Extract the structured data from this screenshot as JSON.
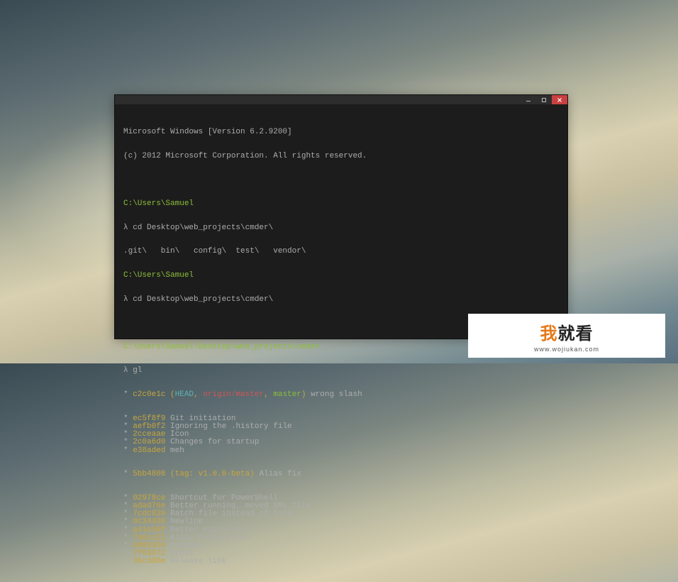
{
  "header": {
    "line1": "Microsoft Windows [Version 6.2.9200]",
    "line2": "(c) 2012 Microsoft Corporation. All rights reserved."
  },
  "block1": {
    "cwd": "C:\\Users\\Samuel",
    "prompt": "λ ",
    "cmd": "cd Desktop\\web_projects\\cmder\\",
    "listing": ".git\\   bin\\   config\\  test\\   vendor\\"
  },
  "block2": {
    "cwd": "C:\\Users\\Samuel",
    "prompt": "λ ",
    "cmd": "cd Desktop\\web_projects\\cmder\\"
  },
  "block3": {
    "cwd": "C:\\Users\\Samuel\\Desktop\\web_projects\\cmder",
    "prompt": "λ ",
    "cmd": "gl"
  },
  "firstCommit": {
    "star": "* ",
    "hash": "c2c0e1c",
    "open": " (",
    "head": "HEAD",
    "sep1": ", ",
    "origin": "origin/master",
    "sep2": ", ",
    "master": "master",
    "close": ")",
    "msg": " wrong slash"
  },
  "commits": [
    {
      "hash": "ec5f8f9",
      "msg": " Git initiation"
    },
    {
      "hash": "aefb0f2",
      "msg": " Ignoring the .history file"
    },
    {
      "hash": "2cceaae",
      "msg": " Icon"
    },
    {
      "hash": "2c0a6d0",
      "msg": " Changes for startup"
    },
    {
      "hash": "e38aded",
      "msg": " meh"
    }
  ],
  "tagCommit": {
    "star": "* ",
    "hash": "5bb4808",
    "open": " (",
    "tag": "tag: v1.0.0-beta",
    "close": ")",
    "msg": " Alias fix"
  },
  "commits2": [
    {
      "hash": "02978ce",
      "msg": " Shortcut for PowerShell"
    },
    {
      "hash": "adad76e",
      "msg": " Better running, moved XML file"
    },
    {
      "hash": "7cdc039",
      "msg": " Batch file instead of link"
    },
    {
      "hash": "8c34d36",
      "msg": " Newline"
    },
    {
      "hash": "a41e50f",
      "msg": " Better explained"
    },
    {
      "hash": "7a6cc21",
      "msg": " Alias explanation"
    },
    {
      "hash": "9d86358",
      "msg": " License"
    },
    {
      "hash": "7f63672",
      "msg": " Typos"
    },
    {
      "hash": "36cd80e",
      "msg": " Release link"
    }
  ],
  "star": "* ",
  "watermark": {
    "accent": "我",
    "rest": "就看",
    "sub": "www.wojiukan.com"
  }
}
